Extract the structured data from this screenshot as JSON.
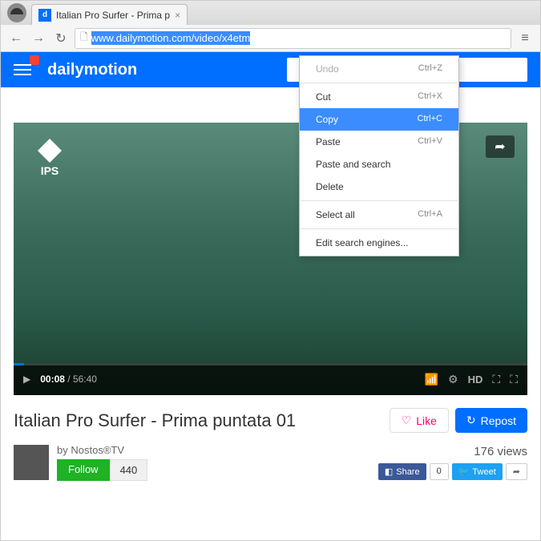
{
  "browser": {
    "tab_title": "Italian Pro Surfer - Prima p",
    "url_selected": "www.dailymotion.com/video/x4etm",
    "nav": {
      "back": "←",
      "forward": "→",
      "reload": "↻"
    }
  },
  "context_menu": {
    "items": [
      {
        "label": "Undo",
        "shortcut": "Ctrl+Z",
        "disabled": true
      },
      {
        "sep": true
      },
      {
        "label": "Cut",
        "shortcut": "Ctrl+X"
      },
      {
        "label": "Copy",
        "shortcut": "Ctrl+C",
        "highlighted": true
      },
      {
        "label": "Paste",
        "shortcut": "Ctrl+V"
      },
      {
        "label": "Paste and search",
        "shortcut": ""
      },
      {
        "label": "Delete",
        "shortcut": ""
      },
      {
        "sep": true
      },
      {
        "label": "Select all",
        "shortcut": "Ctrl+A"
      },
      {
        "sep": true
      },
      {
        "label": "Edit search engines...",
        "shortcut": ""
      }
    ]
  },
  "site": {
    "brand": "dailymotion",
    "ips_label": "IPS"
  },
  "player": {
    "current_time": "00:08",
    "duration": "56:40",
    "hd": "HD"
  },
  "video": {
    "title": "Italian Pro Surfer - Prima puntata 01",
    "like_label": "Like",
    "repost_label": "Repost",
    "by": "by",
    "channel": "Nostos®TV",
    "follow": "Follow",
    "follow_count": "440",
    "views": "176 views",
    "fb_share": "Share",
    "fb_count": "0",
    "tweet": "Tweet"
  }
}
